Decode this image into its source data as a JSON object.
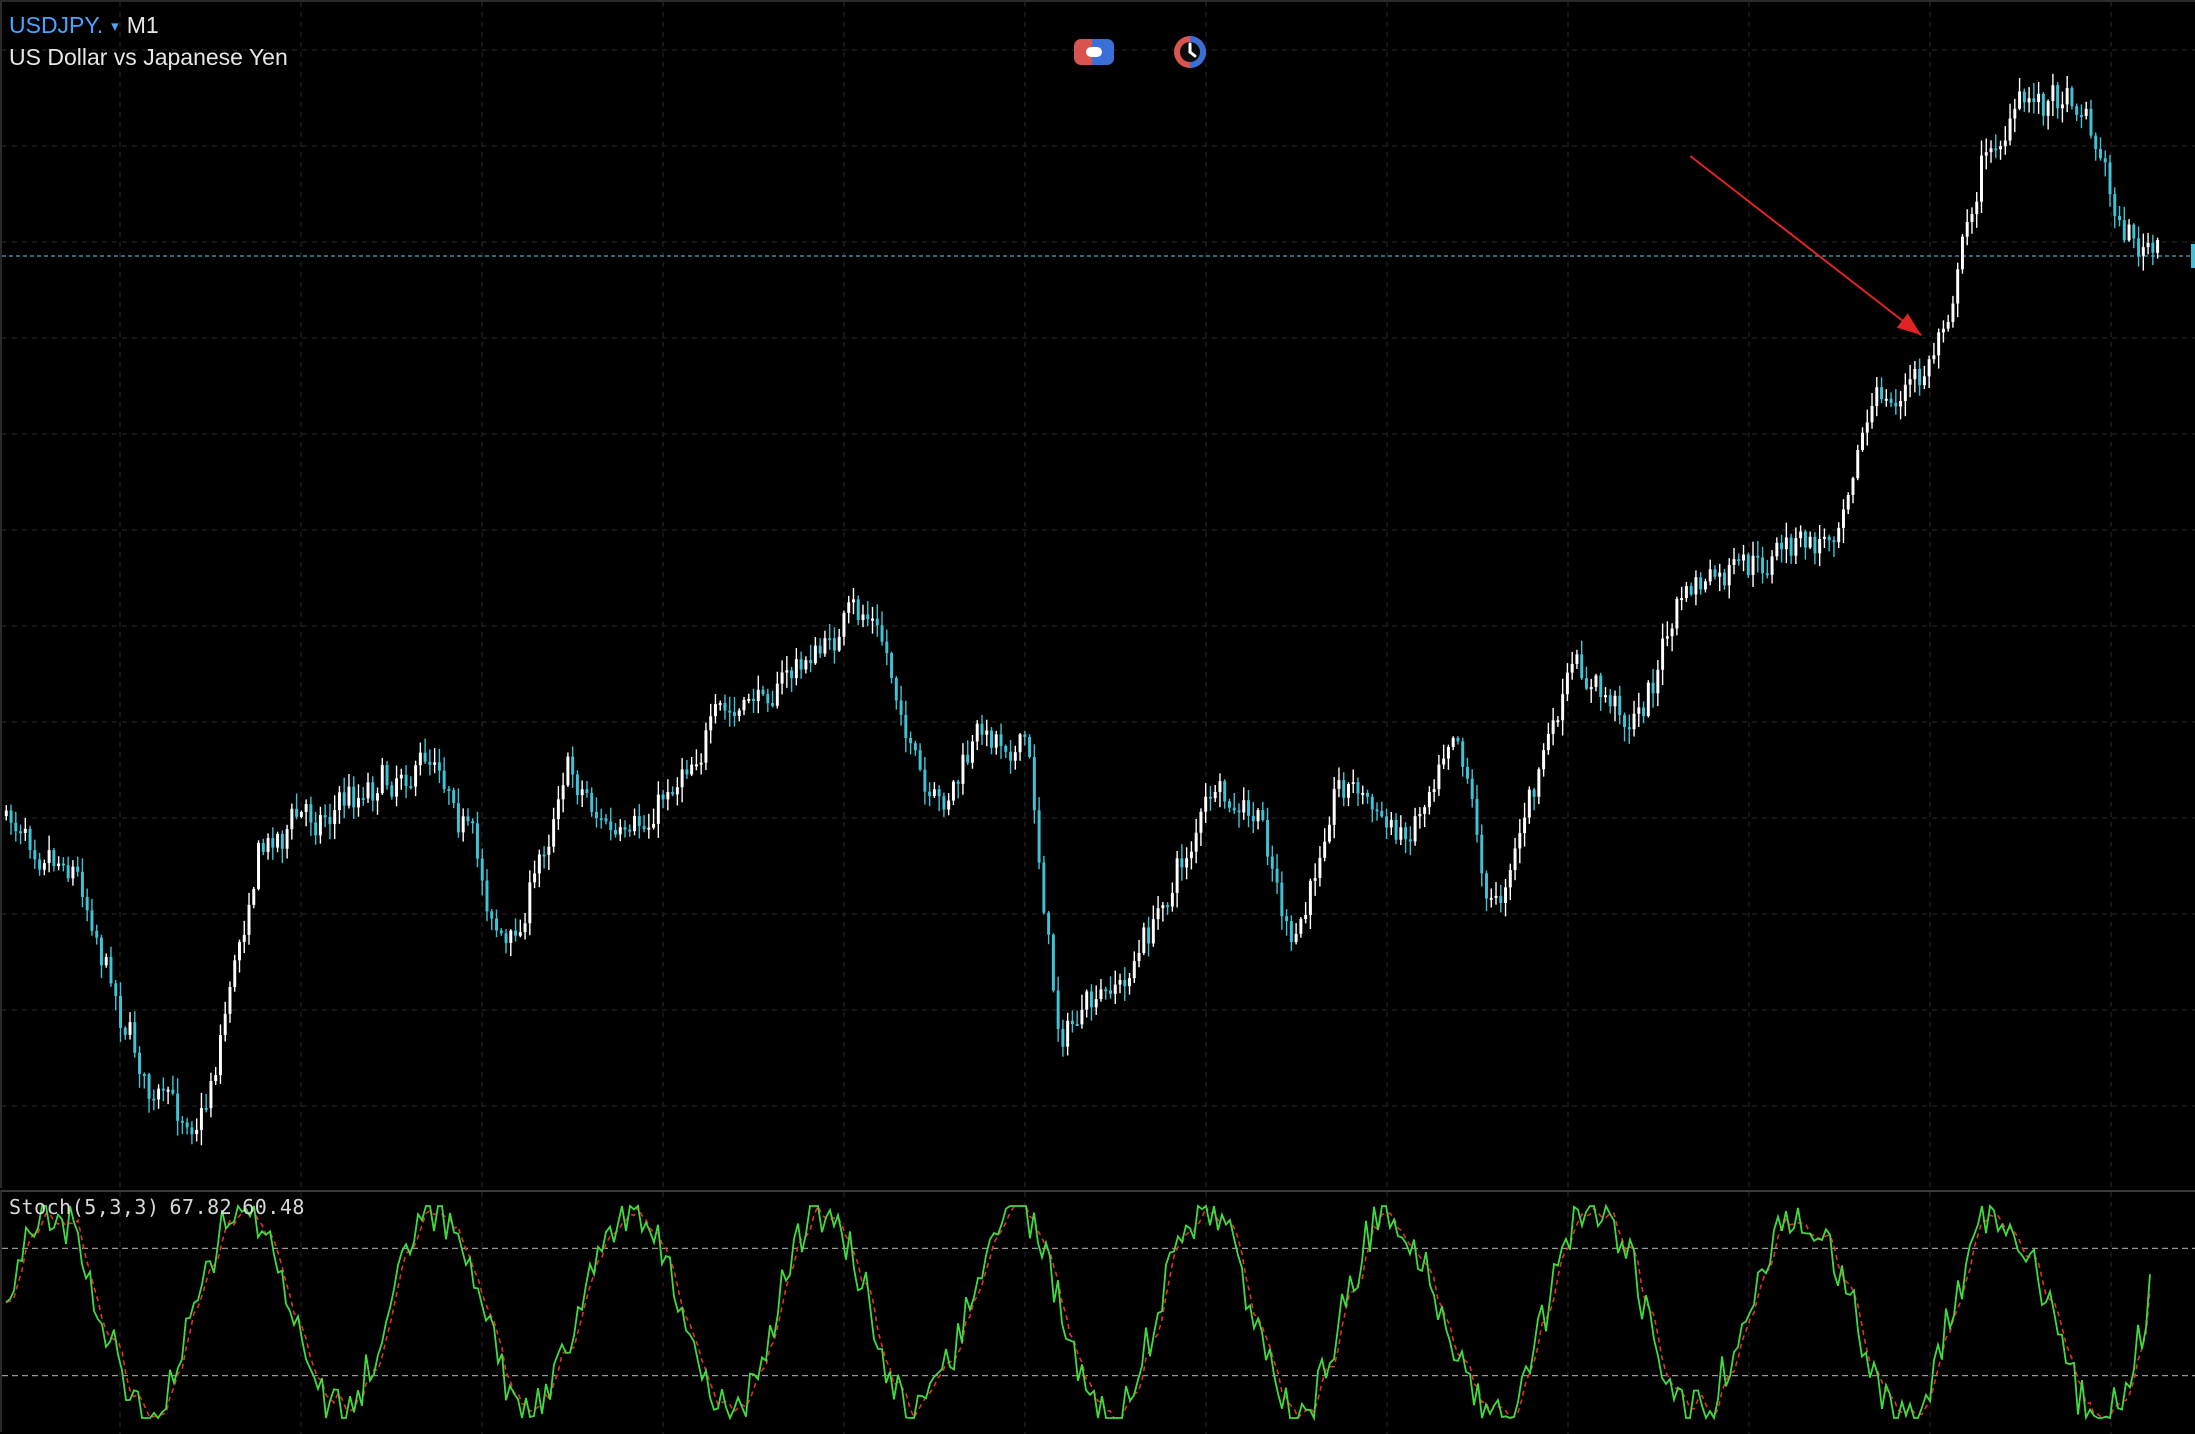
{
  "header": {
    "symbol": "USDJPY.",
    "caret": "▾",
    "timeframe": "M1",
    "description": "US Dollar vs Japanese Yen"
  },
  "toolbar": {
    "icons": [
      "toggle-switch-icon",
      "clock-timer-icon"
    ]
  },
  "colors": {
    "background": "#000000",
    "bull_candle": "#ffffff",
    "bear_candle": "#3fc3d6",
    "grid": "#1c1c1c",
    "price_line": "#3d8c9a",
    "arrow": "#e02424",
    "stoch_main": "#3fdc3f",
    "stoch_signal": "#e03030",
    "level_line": "#9a9a9a"
  },
  "annotation": {
    "type": "arrow",
    "color": "#e02424"
  },
  "indicator": {
    "name": "Stoch(5,3,3)",
    "main_value": "67.82",
    "signal_value": "60.48",
    "levels": [
      20,
      80
    ]
  },
  "chart_data": {
    "type": "candlestick",
    "symbol": "USDJPY.",
    "timeframe": "M1",
    "price_anchors": [
      [
        0,
        580
      ],
      [
        50,
        620
      ],
      [
        100,
        780
      ],
      [
        140,
        800
      ],
      [
        180,
        600
      ],
      [
        260,
        560
      ],
      [
        310,
        540
      ],
      [
        360,
        690
      ],
      [
        400,
        540
      ],
      [
        440,
        610
      ],
      [
        500,
        520
      ],
      [
        560,
        480
      ],
      [
        620,
        430
      ],
      [
        660,
        590
      ],
      [
        700,
        520
      ],
      [
        730,
        530
      ],
      [
        750,
        740
      ],
      [
        800,
        700
      ],
      [
        860,
        570
      ],
      [
        900,
        590
      ],
      [
        920,
        690
      ],
      [
        950,
        550
      ],
      [
        1000,
        600
      ],
      [
        1035,
        500
      ],
      [
        1060,
        660
      ],
      [
        1120,
        470
      ],
      [
        1160,
        520
      ],
      [
        1200,
        420
      ],
      [
        1300,
        385
      ],
      [
        1330,
        290
      ],
      [
        1370,
        270
      ],
      [
        1395,
        180
      ],
      [
        1410,
        110
      ],
      [
        1450,
        70
      ],
      [
        1480,
        60
      ],
      [
        1510,
        160
      ],
      [
        1540,
        190
      ]
    ],
    "stochastic": {
      "params": "5,3,3",
      "main": 67.82,
      "signal": 60.48,
      "ylim": [
        0,
        100
      ],
      "levels": [
        20,
        80
      ]
    }
  }
}
